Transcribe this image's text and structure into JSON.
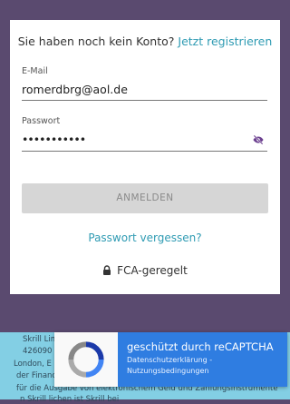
{
  "signup": {
    "prompt": "Sie haben noch kein Konto?",
    "link": "Jetzt registrieren"
  },
  "email": {
    "label": "E-Mail",
    "value": "romerdbrg@aol.de"
  },
  "password": {
    "label": "Passwort",
    "value": "•••••••••••",
    "toggle_icon": "eye-off-icon"
  },
  "login_button": "ANMELDEN",
  "forgot_link": "Passwort vergessen?",
  "fca": {
    "icon": "lock-icon",
    "label": "FCA-geregelt"
  },
  "footer": {
    "lines": [
      "Skrill Lim",
      "426090",
      "London, E",
      "der Financ",
      "für die Ausgabe von elektronischem Geld und Zahlungsinstrumente",
      "n          Skrill  lichen   ist      Skrill  bei"
    ]
  },
  "recaptcha": {
    "title": "geschützt durch reCAPTCHA",
    "privacy": "Datenschutzerklärung",
    "separator": " - ",
    "terms": "Nutzungsbedingungen"
  },
  "colors": {
    "background": "#5a4a6f",
    "accent": "#2f9bb3",
    "footer": "#83cfe4",
    "recaptcha": "#2f7de1"
  }
}
